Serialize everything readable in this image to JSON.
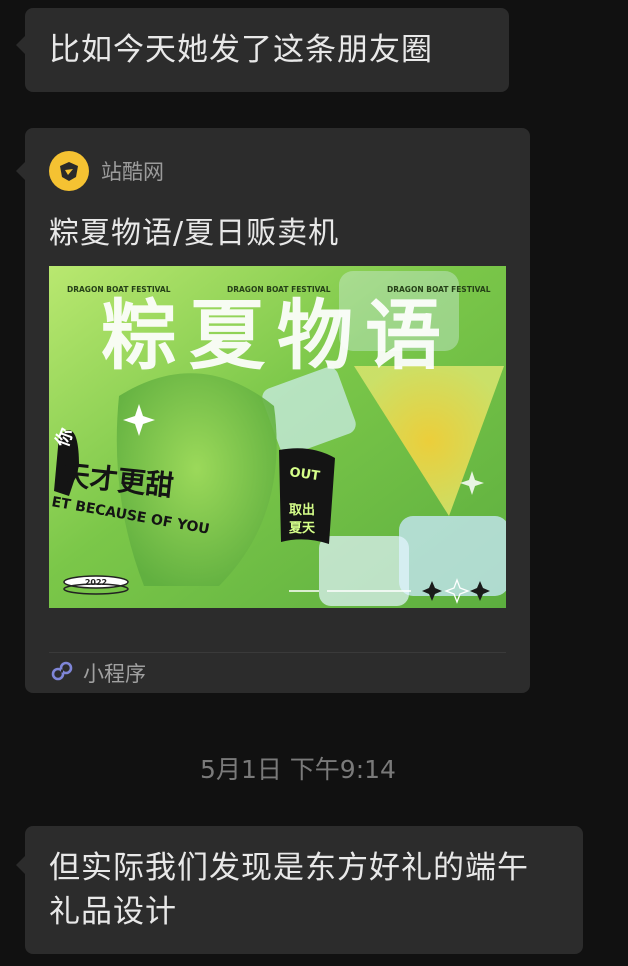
{
  "messages": [
    {
      "type": "text",
      "text": "比如今天她发了这条朋友圈"
    },
    {
      "type": "mini-program-card",
      "source": "站酷网",
      "title": "粽夏物语/夏日贩卖机",
      "mini_program_label": "小程序",
      "poster": {
        "top_labels": [
          "DRAGON BOAT FESTIVAL",
          "DRAGON BOAT FESTIVAL",
          "DRAGON BOAT FESTIVAL"
        ],
        "headline": "粽夏物语",
        "ribbon_text": "天才更甜",
        "ribbon_subtext": "ET BECAUSE OF YOU",
        "ribbon_fragment": "你",
        "tag_text_1": "取出",
        "tag_text_2": "夏天",
        "tag_text_3": "OUT",
        "year": "2022",
        "colors": {
          "background": "#8fd15a",
          "yellow": "#f1d13e"
        }
      }
    },
    {
      "type": "timestamp",
      "text": "5月1日 下午9:14"
    },
    {
      "type": "text",
      "text": "但实际我们发现是东方好礼的端午礼品设计"
    }
  ],
  "colors": {
    "background": "#111111",
    "bubble": "#2c2c2c",
    "text": "#e8e8e8",
    "muted": "#9b9b9b",
    "logo": "#f5c232",
    "mini_icon": "#7f86d8"
  }
}
